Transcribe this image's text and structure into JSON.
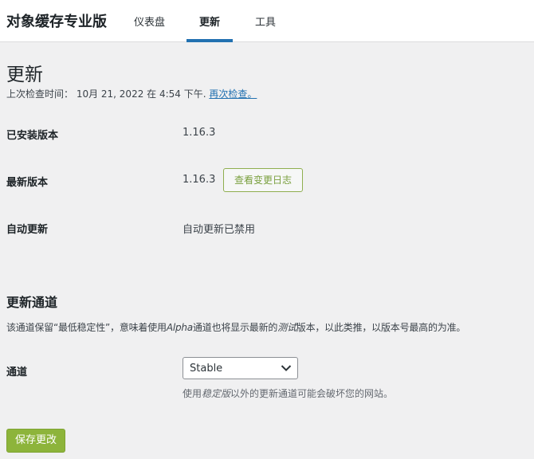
{
  "header": {
    "brand": "对象缓存专业版",
    "tabs": [
      {
        "label": "仪表盘",
        "active": false
      },
      {
        "label": "更新",
        "active": true
      },
      {
        "label": "工具",
        "active": false
      }
    ]
  },
  "page": {
    "title": "更新",
    "last_check_prefix": "上次检查时间： 10月 21, 2022 在 4:54 下午.",
    "check_again_link": "再次检查。"
  },
  "info_rows": [
    {
      "label": "已安装版本",
      "value": "1.16.3"
    },
    {
      "label": "最新版本",
      "value": "1.16.3",
      "button": "查看变更日志"
    },
    {
      "label": "自动更新",
      "value": "自动更新已禁用"
    }
  ],
  "channel_section": {
    "title": "更新通道",
    "desc_part1": "该通道保留“最低稳定性”，意味着使用",
    "desc_italic1": "Alpha",
    "desc_part2": "通道也将显示最新的",
    "desc_italic2": "测试",
    "desc_part3": "版本，以此类推，以版本号最高的为准。",
    "field_label": "通道",
    "select_value": "Stable",
    "help_part1": "使用",
    "help_italic": "稳定版",
    "help_part2": "以外的更新通道可能会破坏您的网站。"
  },
  "actions": {
    "save_label": "保存更改"
  },
  "colors": {
    "tab_underline": "#2271b1",
    "link": "#2271b1",
    "primary_button": "#8db43b",
    "outline_button_border": "#8fae4f"
  },
  "icons": {
    "select_chevron": "chevron-down-icon"
  }
}
